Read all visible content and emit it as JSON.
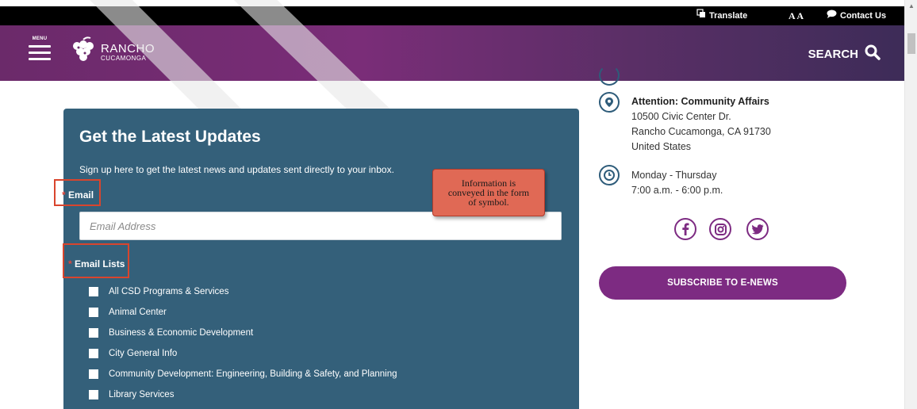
{
  "utility_bar": {
    "translate_label": "Translate",
    "text_size_label": "A A",
    "contact_label": "Contact Us"
  },
  "header": {
    "menu_label": "MENU",
    "logo_line1": "RANCHO",
    "logo_line2": "CUCAMONGA",
    "search_label": "SEARCH"
  },
  "form": {
    "title": "Get the Latest Updates",
    "subtitle": "Sign up here to get the latest news and updates sent directly to your inbox.",
    "required_marker": "*",
    "email_label": "Email",
    "email_placeholder": "Email Address",
    "email_value": "",
    "lists_label": "Email Lists",
    "lists": [
      "All CSD Programs & Services",
      "Animal Center",
      "Business & Economic Development",
      "City General Info",
      "Community Development: Engineering, Building & Safety, and Planning",
      "Library Services"
    ]
  },
  "annotation": {
    "callout_text": "Information is conveyed in the form of symbol."
  },
  "contact": {
    "address_title": "Attention: Community Affairs",
    "address_line1": "10500 Civic Center Dr.",
    "address_line2": "Rancho Cucamonga, CA 91730",
    "address_line3": "United States",
    "hours_days": "Monday - Thursday",
    "hours_time": "7:00 a.m. - 6:00 p.m."
  },
  "social": {
    "icons": [
      "facebook-icon",
      "instagram-icon",
      "twitter-icon"
    ]
  },
  "subscribe_label": "SUBSCRIBE TO E-NEWS",
  "colors": {
    "brand_purple": "#7d2b82",
    "panel_blue": "#34607a",
    "annotation_red": "#d9452d",
    "required_star": "#e0463b"
  }
}
